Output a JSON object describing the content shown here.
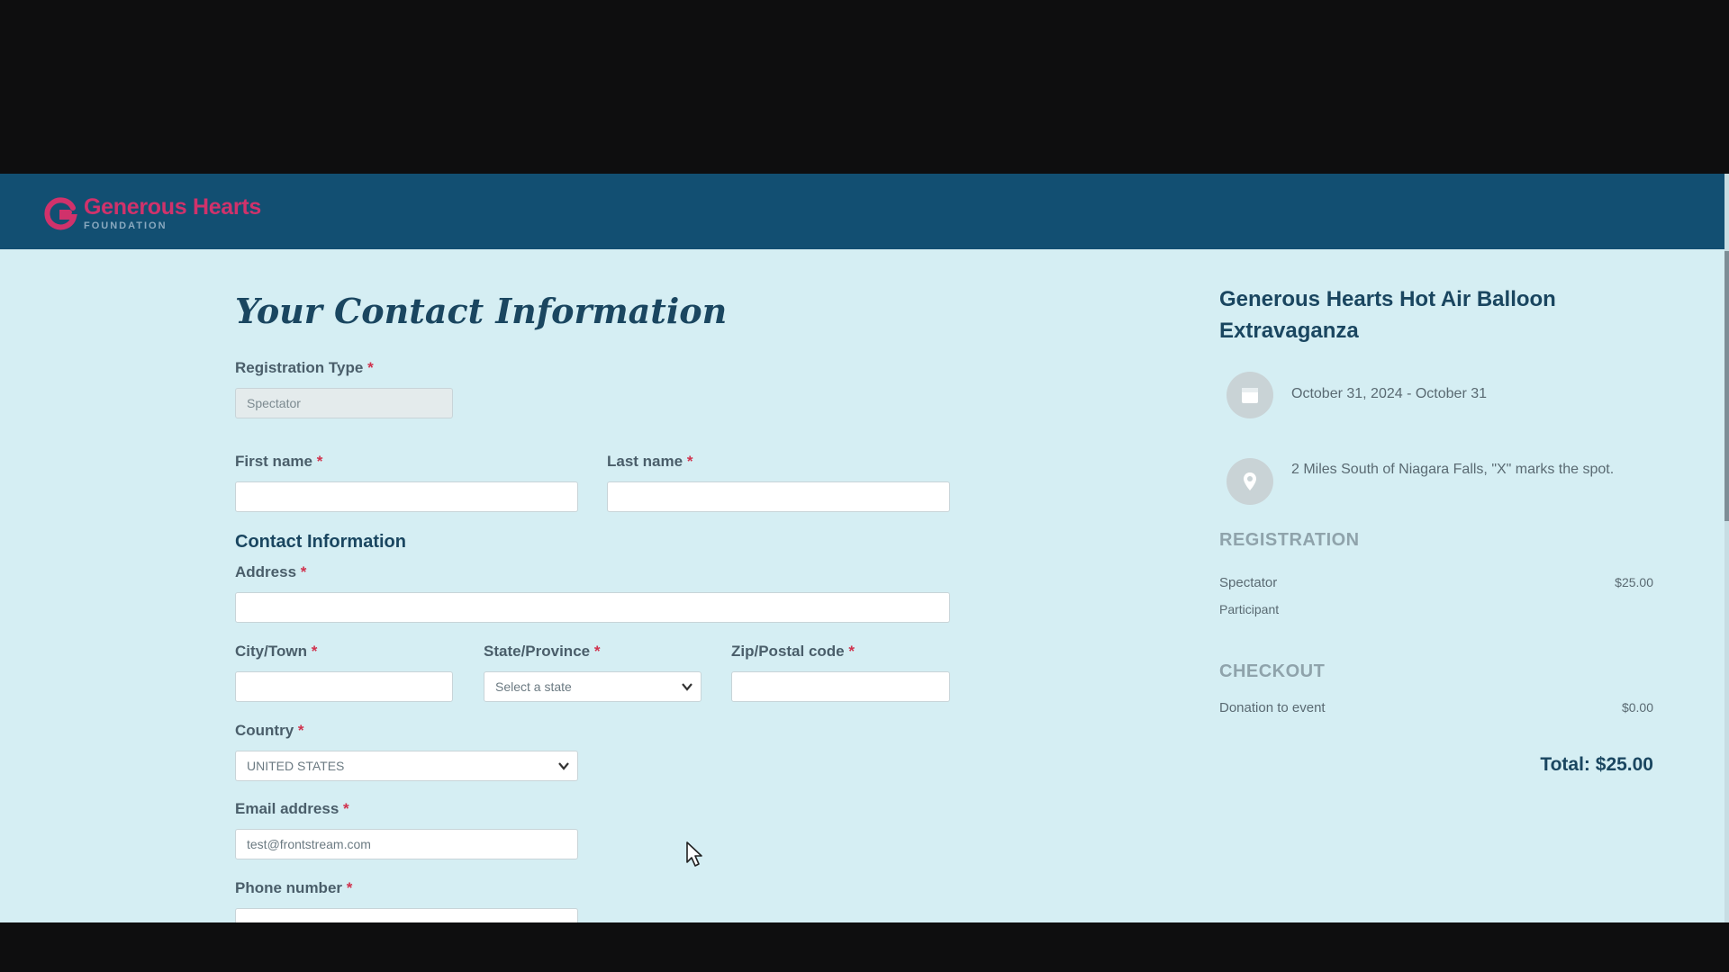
{
  "brand": {
    "name": "Generous Hearts",
    "subtitle": "FOUNDATION",
    "header_color": "#124f72",
    "accent_color": "#d0326b"
  },
  "form": {
    "title": "Your Contact Information",
    "registration_type": {
      "label": "Registration Type",
      "value": "Spectator"
    },
    "first_name": {
      "label": "First name",
      "value": ""
    },
    "last_name": {
      "label": "Last name",
      "value": ""
    },
    "contact_section": "Contact Information",
    "address": {
      "label": "Address",
      "value": ""
    },
    "city": {
      "label": "City/Town",
      "value": ""
    },
    "state": {
      "label": "State/Province",
      "value": "Select a state"
    },
    "zip": {
      "label": "Zip/Postal code",
      "value": ""
    },
    "country": {
      "label": "Country",
      "value": "UNITED STATES"
    },
    "email": {
      "label": "Email address",
      "value": "test@frontstream.com"
    },
    "phone": {
      "label": "Phone number",
      "value": ""
    },
    "required_marker": "*"
  },
  "sidebar": {
    "event_title": "Generous Hearts Hot Air Balloon Extravaganza",
    "date": {
      "icon": "calendar-icon",
      "text": "October 31, 2024 - October 31"
    },
    "location": {
      "icon": "map-pin-icon",
      "text": "2 Miles South of Niagara Falls, \"X\" marks the spot."
    },
    "registration": {
      "heading": "REGISTRATION",
      "items": [
        {
          "label": "Spectator",
          "price": "$25.00"
        },
        {
          "label": "Participant",
          "price": ""
        }
      ]
    },
    "checkout": {
      "heading": "CHECKOUT",
      "items": [
        {
          "label": "Donation to event",
          "price": "$0.00"
        }
      ]
    },
    "total": "Total: $25.00"
  }
}
